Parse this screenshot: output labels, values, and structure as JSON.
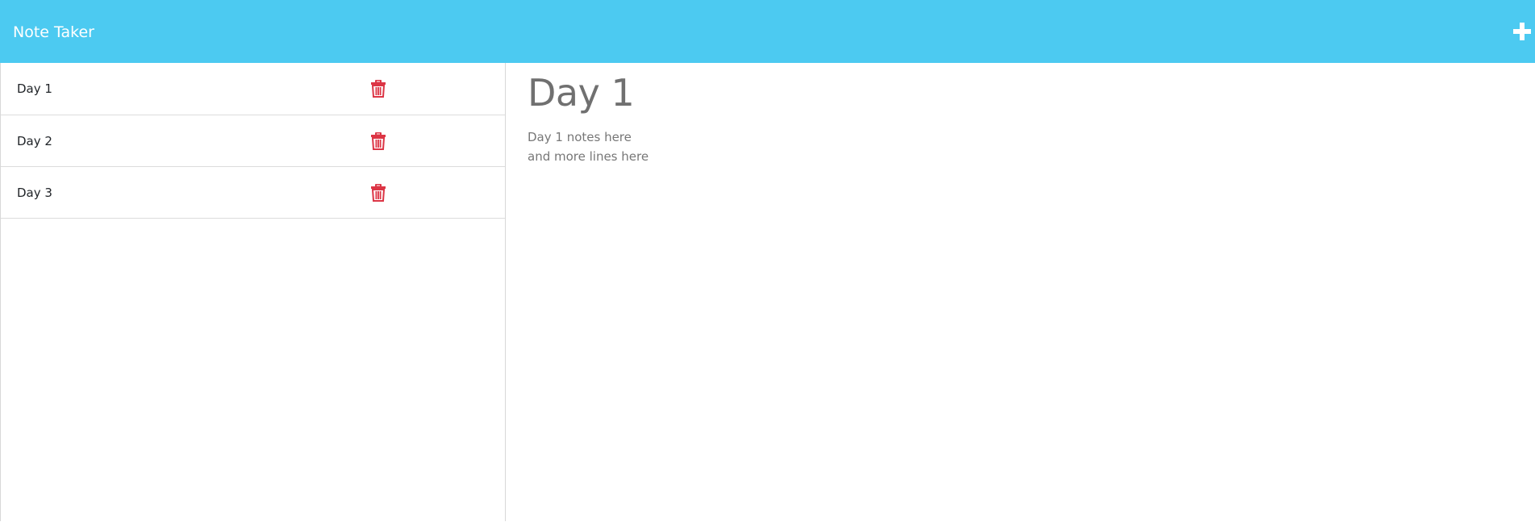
{
  "navbar": {
    "title": "Note Taker",
    "background_color": "#4ccaf1",
    "add_icon": "plus-icon"
  },
  "notes": [
    {
      "title": "Day 1",
      "delete_icon": "trash-icon"
    },
    {
      "title": "Day 2",
      "delete_icon": "trash-icon"
    },
    {
      "title": "Day 3",
      "delete_icon": "trash-icon"
    }
  ],
  "active_note": {
    "title": "Day 1",
    "lines": [
      "Day 1 notes here",
      "and more lines here"
    ]
  },
  "colors": {
    "delete_icon": "#dc3545",
    "heading_text": "#707070"
  }
}
